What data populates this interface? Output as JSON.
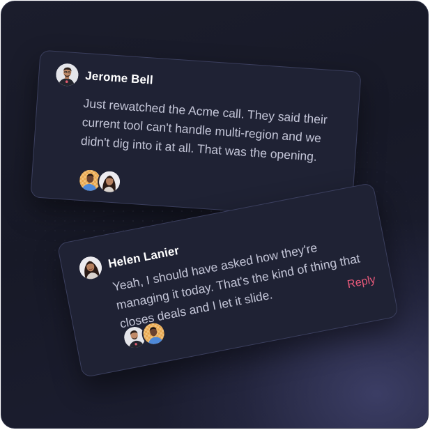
{
  "comments": [
    {
      "author": "Jerome Bell",
      "text": "Just rewatched the Acme call. They said their current tool can't handle multi-region and we didn't dig into it at all. That was the opening.",
      "reactors": [
        "checkered-avatar",
        "woman-avatar"
      ]
    },
    {
      "author": "Helen Lanier",
      "text": "Yeah, I should have asked how they're managing it today. That's the kind of thing that closes deals and I let it slide.",
      "reply_label": "Reply",
      "reactors": [
        "man-avatar",
        "checkered-avatar"
      ]
    }
  ],
  "colors": {
    "background": "#1b1d2c",
    "card": "#1f2234",
    "card_border": "#3b3f5e",
    "reply_accent": "#e8597a",
    "name_text": "#ffffff",
    "body_text": "#c4c6d8"
  }
}
